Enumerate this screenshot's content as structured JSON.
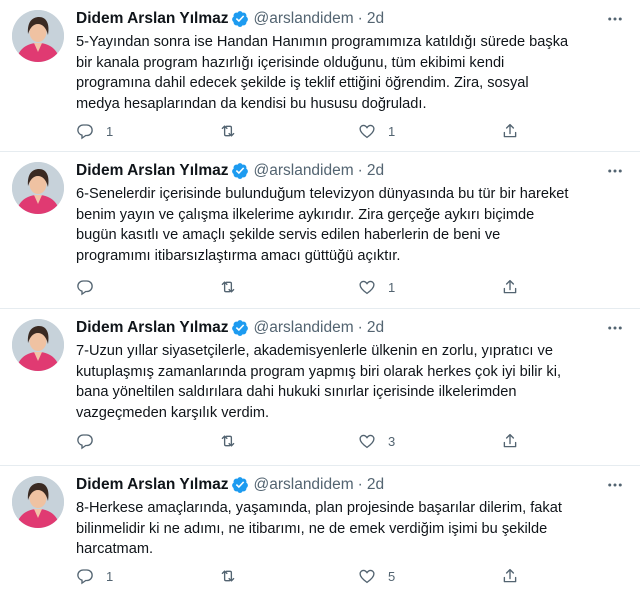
{
  "colors": {
    "text": "#0f1419",
    "muted": "#536471",
    "verified": "#1d9bf0",
    "divider": "#e6ecf0",
    "avatar_jacket": "#e03a72"
  },
  "icons": {
    "verified": "verified-badge-icon",
    "more": "more-dots-icon",
    "reply": "reply-icon",
    "retweet": "retweet-icon",
    "like": "heart-icon",
    "share": "share-icon"
  },
  "tweets": [
    {
      "author": "Didem Arslan Yılmaz",
      "handle": "@arslandidem",
      "separator": "·",
      "time": "2d",
      "text": "5-Yayından sonra ise  Handan Hanımın programımıza katıldığı sürede başka\nbir kanala program hazırlığı içerisinde olduğunu, tüm ekibimi kendi\nprogramına dahil edecek şekilde iş teklif ettiğini öğrendim. Zira, sosyal\nmedya hesaplarından da kendisi bu hususu doğruladı.",
      "replies": "1",
      "retweets": "",
      "likes": "1"
    },
    {
      "author": "Didem Arslan Yılmaz",
      "handle": "@arslandidem",
      "separator": "·",
      "time": "2d",
      "text": "6-Senelerdir içerisinde bulunduğum televizyon dünyasında bu tür bir hareket\nbenim yayın ve çalışma ilkelerime aykırıdır. Zira gerçeğe aykırı biçimde\nbugün kasıtlı ve amaçlı şekilde servis edilen  haberlerin de beni ve\nprogramımı itibarsızlaştırma amacı güttüğü açıktır.",
      "replies": "",
      "retweets": "",
      "likes": "1"
    },
    {
      "author": "Didem Arslan Yılmaz",
      "handle": "@arslandidem",
      "separator": "·",
      "time": "2d",
      "text": "7-Uzun yıllar siyasetçilerle, akademisyenlerle ülkenin en zorlu, yıpratıcı ve\nkutuplaşmış zamanlarında program yapmış biri olarak herkes çok iyi bilir ki,\nbana yöneltilen saldırılara dahi hukuki sınırlar içerisinde ilkelerimden\nvazgeçmeden karşılık verdim.",
      "replies": "",
      "retweets": "",
      "likes": "3"
    },
    {
      "author": "Didem Arslan Yılmaz",
      "handle": "@arslandidem",
      "separator": "·",
      "time": "2d",
      "text": "8-Herkese amaçlarında, yaşamında, plan projesinde başarılar dilerim, fakat\nbilinmelidir ki ne adımı, ne itibarımı,  ne de emek verdiğim işimi bu şekilde\nharcatmam.",
      "replies": "1",
      "retweets": "",
      "likes": "5"
    }
  ]
}
